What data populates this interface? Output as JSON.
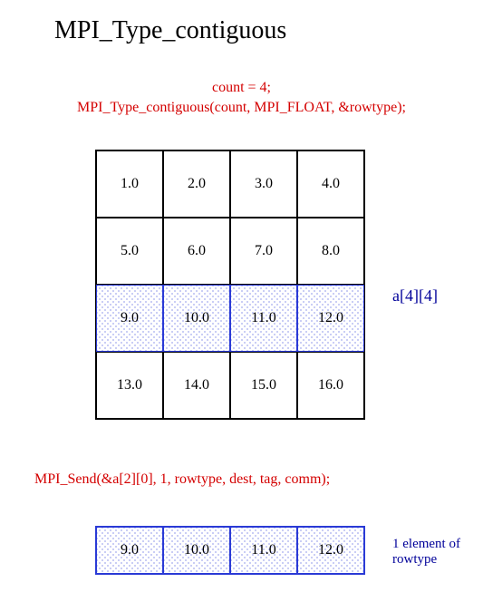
{
  "title": "MPI_Type_contiguous",
  "count_statement": "count = 4;",
  "type_call": "MPI_Type_contiguous(count, MPI_FLOAT, &rowtype);",
  "matrix": {
    "label": "a[4][4]",
    "rows": [
      [
        "1.0",
        "2.0",
        "3.0",
        "4.0"
      ],
      [
        "5.0",
        "6.0",
        "7.0",
        "8.0"
      ],
      [
        "9.0",
        "10.0",
        "11.0",
        "12.0"
      ],
      [
        "13.0",
        "14.0",
        "15.0",
        "16.0"
      ]
    ],
    "highlight_row_index": 2
  },
  "send_call": "MPI_Send(&a[2][0], 1, rowtype, dest, tag, comm);",
  "row_element": {
    "values": [
      "9.0",
      "10.0",
      "11.0",
      "12.0"
    ],
    "label": "1 element of\nrowtype"
  },
  "colors": {
    "accent_red": "#d40000",
    "accent_blue": "#000099",
    "highlight_blue": "#2a3ad6"
  }
}
